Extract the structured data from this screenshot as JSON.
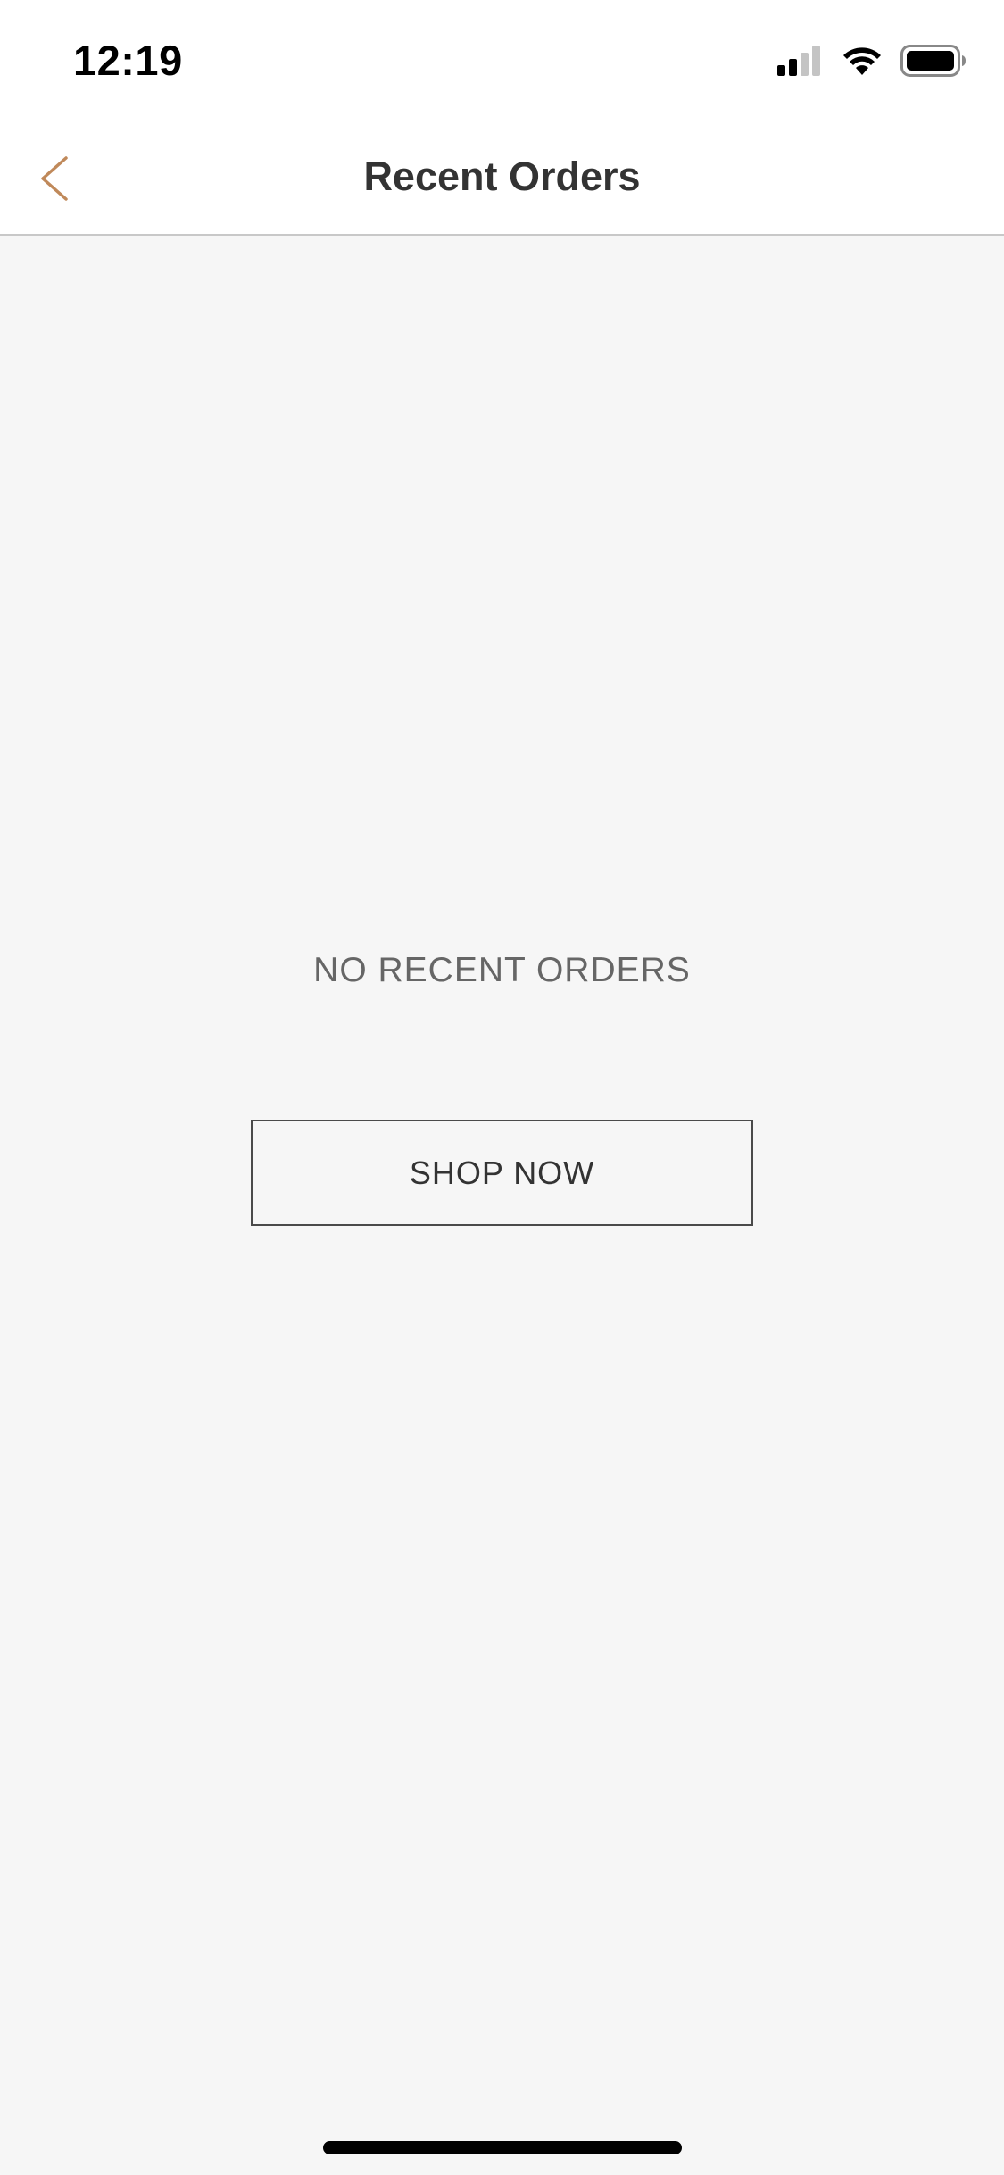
{
  "status_bar": {
    "time": "12:19",
    "icons": [
      "cellular-signal-icon",
      "wifi-icon",
      "battery-icon"
    ]
  },
  "nav": {
    "title": "Recent Orders",
    "back_icon": "chevron-left-icon",
    "accent_color": "#c0895a"
  },
  "content": {
    "empty_message": "NO RECENT ORDERS",
    "shop_now_label": "SHOP NOW"
  },
  "colors": {
    "background": "#f6f6f6",
    "header_background": "#ffffff",
    "title_text": "#333333",
    "empty_text": "#666666"
  }
}
